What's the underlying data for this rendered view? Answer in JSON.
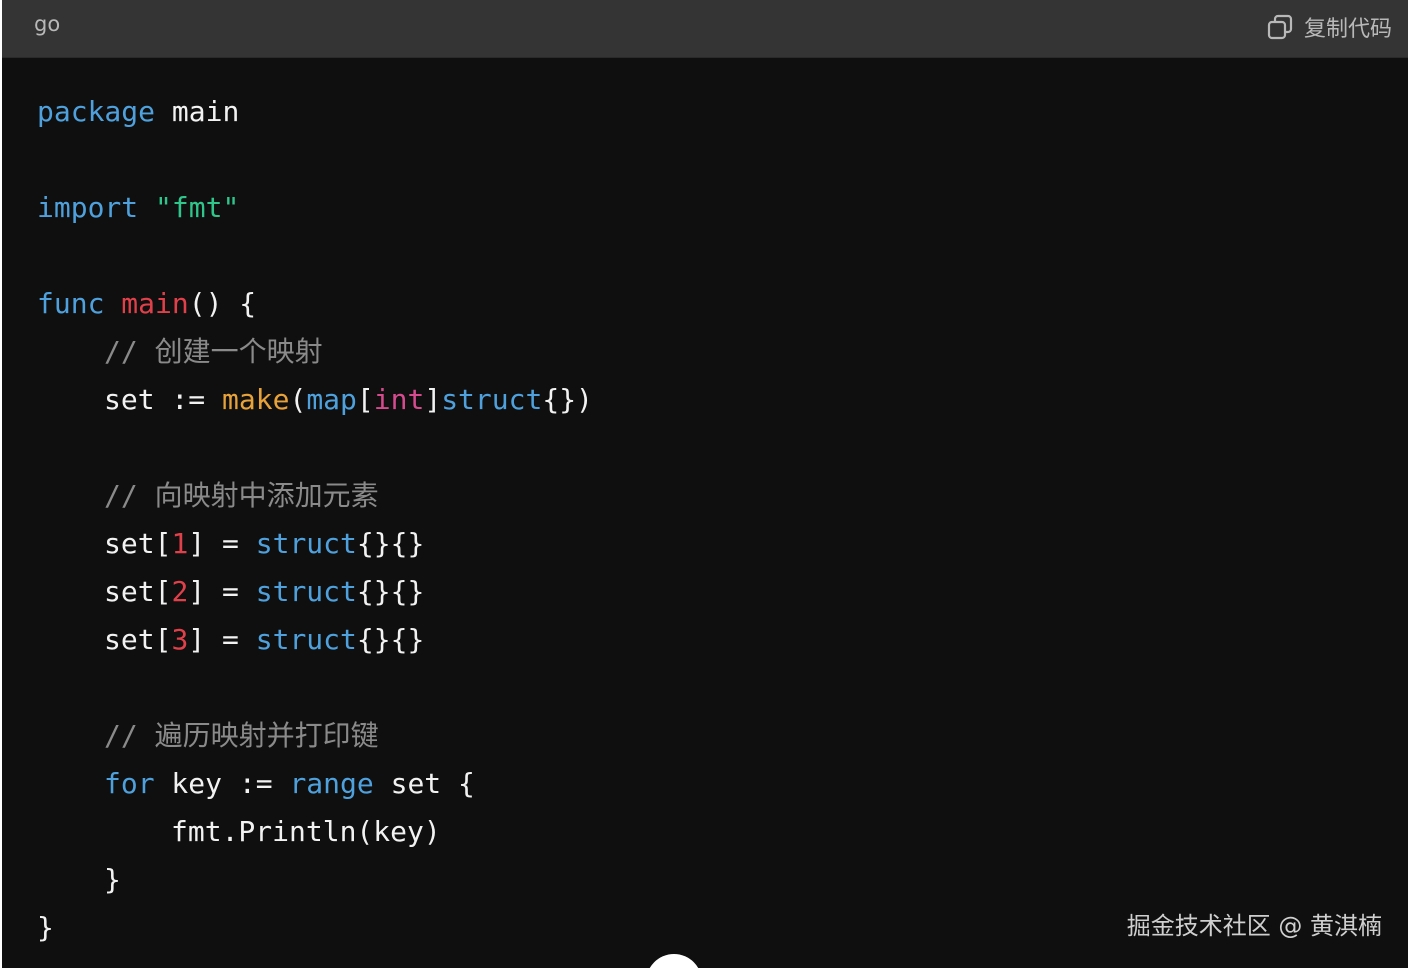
{
  "header": {
    "language": "go",
    "copy_label": "复制代码"
  },
  "code": {
    "l1": {
      "kw": "package",
      "rest": " main"
    },
    "l2": {
      "kw": "import",
      "str": "\"fmt\""
    },
    "l3": {
      "kw": "func",
      "name": "main",
      "rest": "() {"
    },
    "l4": {
      "comment": "// 创建一个映射"
    },
    "l5": {
      "a": "set := ",
      "make": "make",
      "p1": "(",
      "map": "map",
      "b1": "[",
      "int": "int",
      "b2": "]",
      "struct": "struct",
      "tail": "{})"
    },
    "l6": {
      "comment": "// 向映射中添加元素"
    },
    "l7": {
      "a": "set[",
      "n": "1",
      "b": "] = ",
      "struct": "struct",
      "tail": "{}{}"
    },
    "l8": {
      "a": "set[",
      "n": "2",
      "b": "] = ",
      "struct": "struct",
      "tail": "{}{}"
    },
    "l9": {
      "a": "set[",
      "n": "3",
      "b": "] = ",
      "struct": "struct",
      "tail": "{}{}"
    },
    "l10": {
      "comment": "// 遍历映射并打印键"
    },
    "l11": {
      "for": "for",
      "a": " key := ",
      "range": "range",
      "b": " set {"
    },
    "l12": {
      "text": "fmt.Println(key)"
    },
    "l13": {
      "text": "}"
    },
    "l14": {
      "text": "}"
    }
  },
  "watermark": "掘金技术社区 @ 黄淇楠",
  "colors": {
    "background": "#0f0f0f",
    "header": "#343434",
    "keyword": "#4ea1dd",
    "function": "#e0404a",
    "string": "#2fc68b",
    "comment": "#8a8a8a",
    "builtin": "#e8a23a",
    "number": "#e0404a",
    "type": "#d64b8f"
  },
  "icons": {
    "copy": "copy-icon"
  }
}
